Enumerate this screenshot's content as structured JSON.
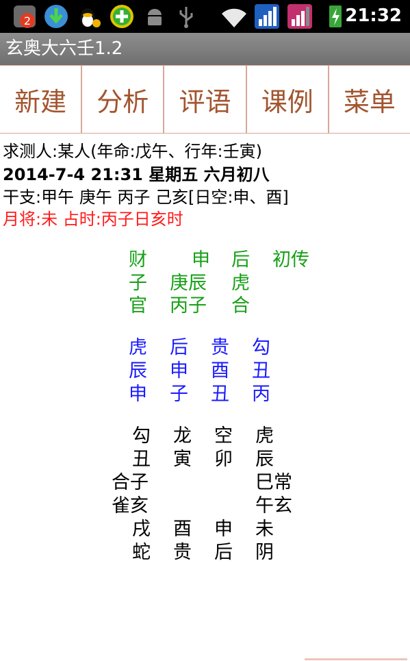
{
  "status_bar": {
    "time": "21:32",
    "notification_count": "2",
    "icons": [
      "notification-badge-icon",
      "download-icon",
      "qq-penguin-icon",
      "add-app-icon",
      "android-debug-icon",
      "usb-icon",
      "wifi-icon",
      "signal-icon",
      "signal-alt-icon",
      "battery-charging-icon"
    ]
  },
  "app": {
    "title": "玄奥大六壬1.2"
  },
  "toolbar": [
    "新建",
    "分析",
    "评语",
    "课例",
    "菜单"
  ],
  "info": {
    "person": "求测人:某人(年命:戊午、行年:壬寅)",
    "datetime": "2014-7-4 21:31  星期五 六月初八",
    "ganzhi": "干支:甲午 庚午 丙子 己亥[日空:申、酉]",
    "general": "月将:未   占时:丙子日亥时"
  },
  "transmissions": [
    [
      "财",
      "申",
      "后",
      "初传"
    ],
    [
      "子",
      "庚辰",
      "虎"
    ],
    [
      "官",
      "丙子",
      "合"
    ]
  ],
  "four_lessons": [
    [
      "虎",
      "后",
      "贵",
      "勾"
    ],
    [
      "辰",
      "申",
      "酉",
      "丑"
    ],
    [
      "申",
      "子",
      "丑",
      "丙"
    ]
  ],
  "heaven_plate": {
    "top_generals": [
      "勾",
      "龙",
      "空",
      "虎"
    ],
    "top_branches": [
      "丑",
      "寅",
      "卯",
      "辰"
    ],
    "left": [
      "合子",
      "雀亥"
    ],
    "right": [
      "巳常",
      "午玄"
    ],
    "bottom_branches": [
      "戌",
      "酉",
      "申",
      "未"
    ],
    "bottom_generals": [
      "蛇",
      "贵",
      "后",
      "阴"
    ]
  },
  "colors": {
    "accent": "#a2552f",
    "green": "#16a016",
    "blue": "#1a1aff",
    "red": "#ff1a1a"
  }
}
